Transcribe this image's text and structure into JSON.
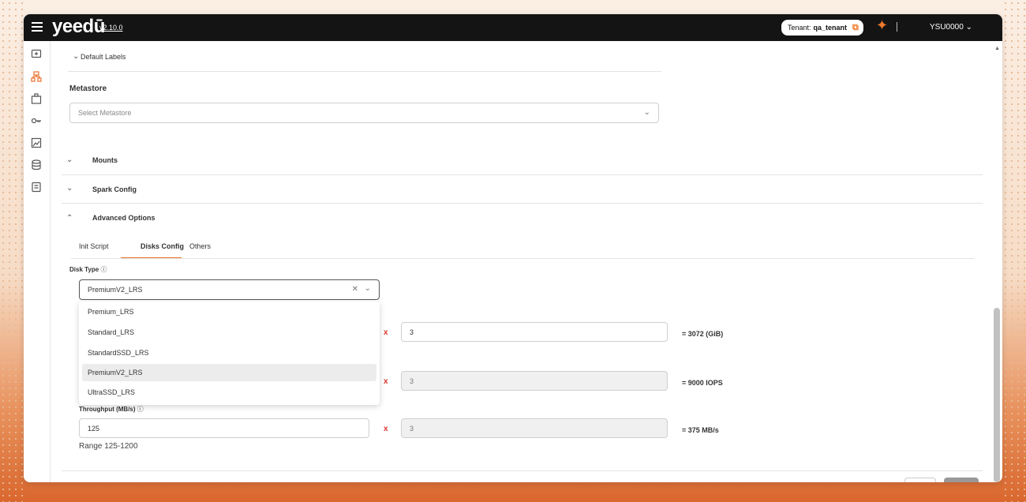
{
  "app": {
    "logo": "yeedū",
    "version": "v2.10.0"
  },
  "header": {
    "tenant_label": "Tenant:",
    "tenant_name": "qa_tenant",
    "user": "YSU0000"
  },
  "sidebar": {
    "icons": [
      "monitor-icon",
      "cluster-icon",
      "workspace-icon",
      "key-icon",
      "image-icon",
      "database-icon",
      "document-icon"
    ]
  },
  "form": {
    "default_labels": "Default Labels",
    "metastore_title": "Metastore",
    "metastore_placeholder": "Select Metastore",
    "sections": {
      "mounts": "Mounts",
      "spark_config": "Spark Config",
      "advanced_options": "Advanced Options"
    },
    "tabs": [
      "Init Script",
      "Disks Config",
      "Others"
    ],
    "active_tab": "Disks Config",
    "disk_type_label": "Disk Type",
    "disk_type_value": "PremiumV2_LRS",
    "disk_type_options": [
      "Premium_LRS",
      "Standard_LRS",
      "StandardSSD_LRS",
      "PremiumV2_LRS",
      "UltraSSD_LRS"
    ],
    "rows": [
      {
        "multiplier_symbol": "x",
        "count": "3",
        "result": "= 3072 (GiB)"
      },
      {
        "multiplier_symbol": "x",
        "count": "3",
        "result": "= 9000 IOPS"
      },
      {
        "label": "Throughput (MB/s)",
        "value": "125",
        "multiplier_symbol": "x",
        "count": "3",
        "result": "= 375 MB/s",
        "range": "Range 125-1200"
      }
    ]
  },
  "colors": {
    "accent": "#e8702a",
    "topbar": "#141414",
    "error": "#d9342b"
  }
}
